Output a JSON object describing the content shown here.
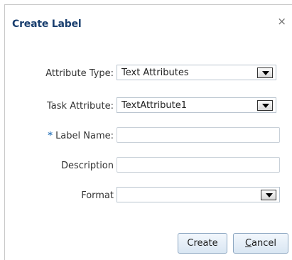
{
  "dialog": {
    "title": "Create Label",
    "close_symbol": "×"
  },
  "fields": {
    "attribute_type": {
      "label": "Attribute Type:",
      "value": "Text Attributes"
    },
    "task_attribute": {
      "label": "Task Attribute:",
      "value": "TextAttribute1"
    },
    "label_name": {
      "required_marker": "*",
      "label": "Label Name:",
      "value": ""
    },
    "description": {
      "label": "Description",
      "value": ""
    },
    "format": {
      "label": "Format",
      "value": ""
    }
  },
  "buttons": {
    "create": "Create",
    "cancel_accel": "C",
    "cancel_rest": "ancel"
  },
  "icons": {
    "close": "close-icon",
    "dropdown": "chevron-down-icon"
  }
}
